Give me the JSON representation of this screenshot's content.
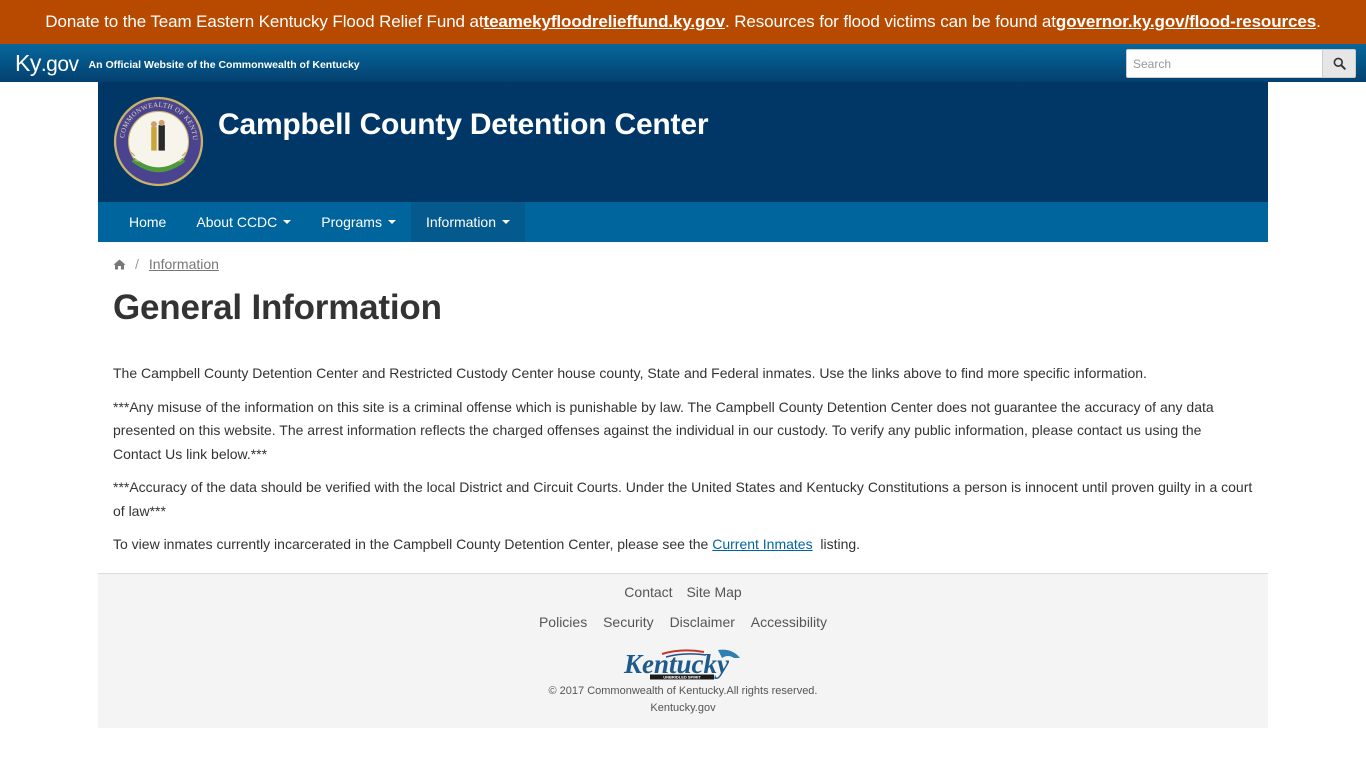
{
  "alert": {
    "text1": "Donate to the Team Eastern Kentucky Flood Relief Fund at ",
    "link1": "teamekyfloodrelieffund.ky.gov",
    "text2": ". Resources for flood victims can be found at ",
    "link2": "governor.ky.gov/flood-resources",
    "text3": "."
  },
  "kygov": {
    "logo_ky": "Ky",
    "logo_gov": ".gov",
    "tagline": "An Official Website of the Commonwealth of Kentucky",
    "search_placeholder": "Search",
    "search_icon": "search-icon"
  },
  "header": {
    "title": "Campbell County Detention Center",
    "seal_icon": "kentucky-seal"
  },
  "nav": {
    "items": [
      {
        "label": "Home",
        "dropdown": false
      },
      {
        "label": "About CCDC",
        "dropdown": true
      },
      {
        "label": "Programs",
        "dropdown": true
      },
      {
        "label": "Information",
        "dropdown": true,
        "active": true
      }
    ]
  },
  "breadcrumb": {
    "home_icon": "home-icon",
    "separator": "/",
    "current": "Information"
  },
  "page": {
    "title": "General Information",
    "paragraphs": [
      "The Campbell County Detention Center and Restricted Custody Center house county, State and Federal inmates.  Use the links above to find more specific information.",
      "***Any misuse of the information on this site is a criminal offense which is punishable by law.  The Campbell County Detention Center does not guarantee the accuracy of any data presented on this website.  The arrest information reflects the charged offenses against the individual in our custody. To verify any public information, please contact us using the Contact Us link below.***",
      "***Accuracy of the data should be verified with the local District and Circuit Courts.  Under the United States and Kentucky Constitutions a person is innocent until proven guilty in a court of law***"
    ],
    "last_para_before": "To view inmates currently incarcerated in the Campbell County Detention Center, please see the ",
    "last_para_link": "Current Inmates",
    "last_para_after": "  listing."
  },
  "footer": {
    "row1": [
      "Contact",
      "Site Map"
    ],
    "row2": [
      "Policies",
      "Security",
      "Disclaimer",
      "Accessibility"
    ],
    "logo_text": "Kentucky",
    "logo_subtext": "UNBRIDLED SPIRIT",
    "copyright": "© 2017 Commonwealth of Kentucky.All rights reserved.",
    "site": "Kentucky.gov"
  },
  "colors": {
    "alert_bg": "#b84a00",
    "kygov_bar": "#03406f",
    "header_bg": "#003767",
    "nav_bg": "#00659c",
    "nav_active": "#045a8c",
    "link": "#00659c",
    "footer_bg": "#f4f4f4"
  }
}
